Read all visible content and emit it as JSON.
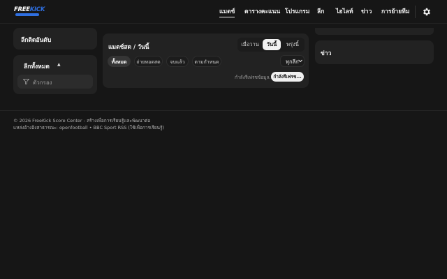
{
  "header": {
    "logo": {
      "part1": "FREE",
      "part2": "KICK"
    },
    "nav": [
      "แมตช์",
      "ตารางคะแนน",
      "โปรแกรม",
      "ลีก",
      "ไฮไลท์",
      "ข่าว",
      "การย้ายทีม"
    ],
    "active_nav": "แมตช์",
    "settings_icon": "gear-icon"
  },
  "sidebar": {
    "ranking_title": "ลีกติดอันดับ",
    "all_leagues_title": "ลีกทั้งหมด",
    "caret_icon": "caret-up-icon",
    "filter_placeholder": "ตัวกรอง",
    "filter_icon": "funnel-icon"
  },
  "matches": {
    "title": "แมตช์สด / วันนี้",
    "day_tabs": [
      "เมื่อวาน",
      "วันนี้",
      "พรุ่งนี้"
    ],
    "active_day": "วันนี้",
    "status_chips": [
      "ทั้งหมด",
      "ถ่ายทอดสด",
      "จบแล้ว",
      "ตามกำหนด"
    ],
    "active_chip": "ทั้งหมด",
    "league_select": "ทุกลีก",
    "loading_text": "กำลังรีเฟรชข้อมูล...",
    "loading_button": "กำลังรีเฟรช..."
  },
  "news": {
    "title": "ข่าว"
  },
  "footer": {
    "line1": "© 2026 FreeKick Score Center - สร้างเพื่อการเรียนรู้และพัฒนาต่อ",
    "line2": "แหล่งอ้างอิงสาธารณะ: openfootball • BBC Sport RSS (ใช้เพื่อการเรียนรู้)"
  },
  "colors": {
    "background": "#161616",
    "card": "#222222",
    "accent": "#2f6fe0"
  }
}
